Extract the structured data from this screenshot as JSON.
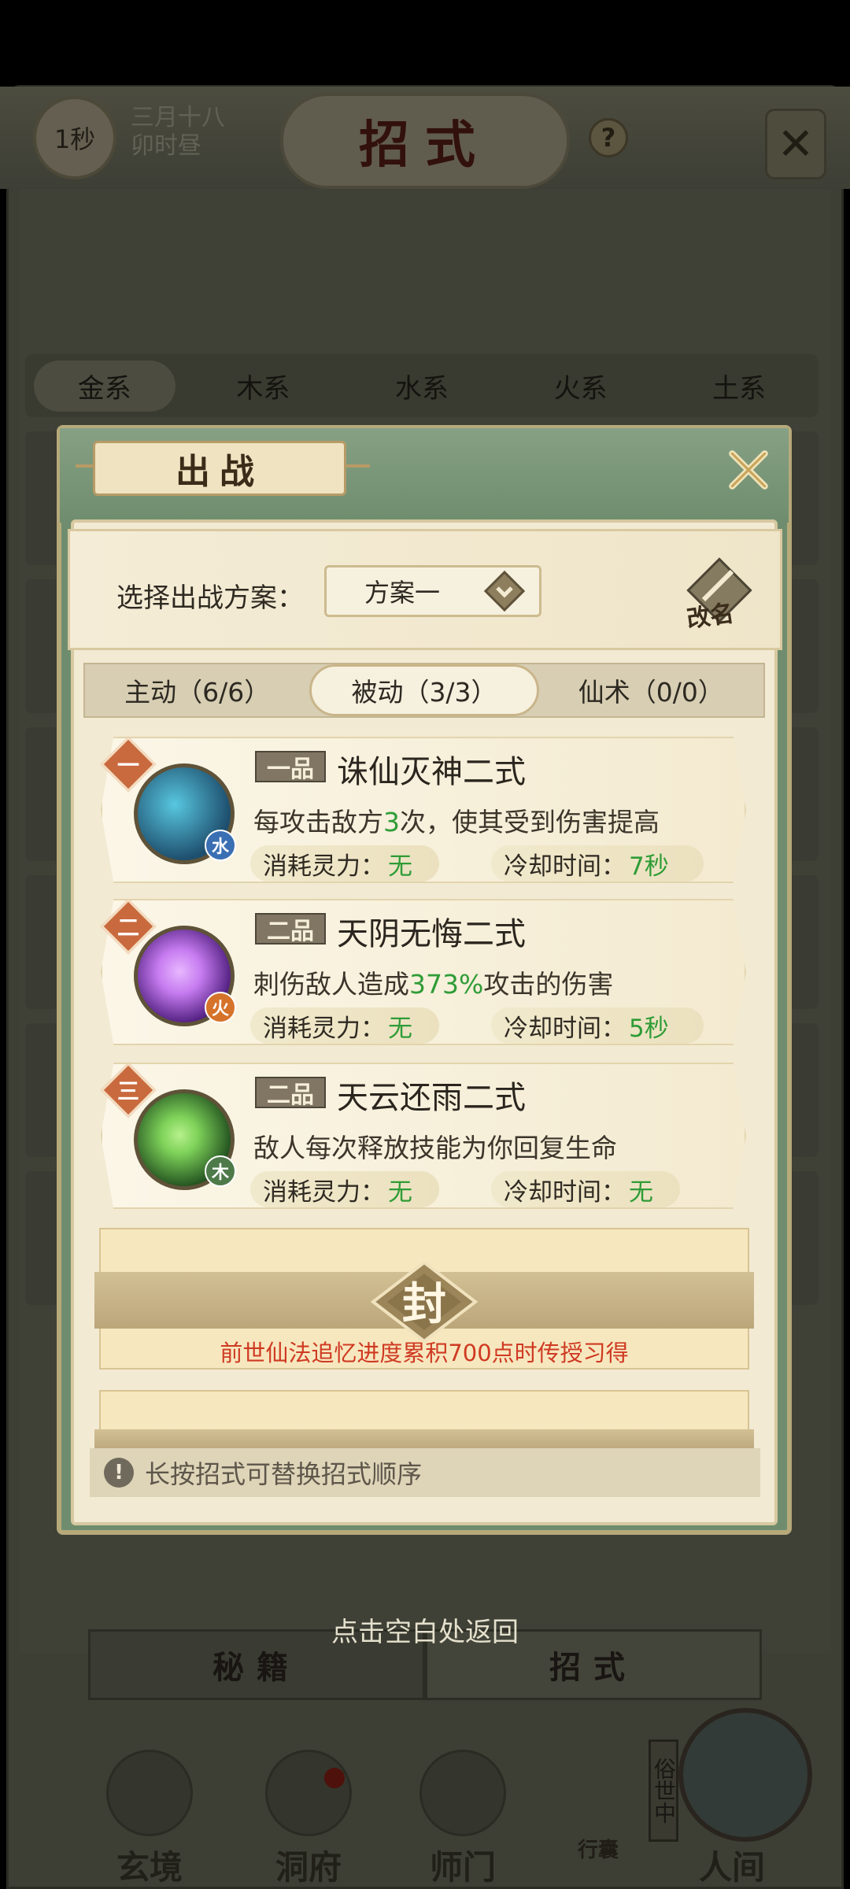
{
  "header": {
    "time_badge": "1秒",
    "date_line1": "三月十八",
    "date_line2": "卯时昼",
    "title": "招式",
    "help_glyph": "?",
    "close_glyph": "✕"
  },
  "element_tabs": [
    "金系",
    "木系",
    "水系",
    "火系",
    "土系"
  ],
  "element_tab_selected": "金系",
  "modal": {
    "title": "出战",
    "plan_label": "选择出战方案：",
    "plan_value": "方案一",
    "rename_label": "改名",
    "tabs": [
      {
        "label": "主动（6/6）",
        "selected": false
      },
      {
        "label": "被动（3/3）",
        "selected": true
      },
      {
        "label": "仙术（0/0）",
        "selected": false
      }
    ],
    "skills": [
      {
        "rank": "一",
        "grade": "一品",
        "name": "诛仙灭神二式",
        "desc_before": "每攻击敌方",
        "desc_hl": "3",
        "desc_after": "次，使其受到伤害提高",
        "element": "水",
        "element_color": "#3b6fb3",
        "cost_label": "消耗灵力：",
        "cost_value": "无",
        "cd_label": "冷却时间：",
        "cd_value": "7秒",
        "icon_colors": [
          "#1e4f6e",
          "#58c7e0"
        ]
      },
      {
        "rank": "二",
        "grade": "二品",
        "name": "天阴无悔二式",
        "desc_before": "刺伤敌人造成",
        "desc_hl": "373%",
        "desc_after": "攻击的伤害",
        "element": "火",
        "element_color": "#d6732a",
        "cost_label": "消耗灵力：",
        "cost_value": "无",
        "cd_label": "冷却时间：",
        "cd_value": "5秒",
        "icon_colors": [
          "#4a1a7a",
          "#c77cf0"
        ]
      },
      {
        "rank": "三",
        "grade": "二品",
        "name": "天云还雨二式",
        "desc_before": "敌人每次释放技能为你回复生命",
        "desc_hl": "",
        "desc_after": "",
        "element": "木",
        "element_color": "#4e7a4a",
        "cost_label": "消耗灵力：",
        "cost_value": "无",
        "cd_label": "冷却时间：",
        "cd_value": "无",
        "icon_colors": [
          "#1d4a1c",
          "#7fd35a"
        ]
      }
    ],
    "sealed": {
      "glyph": "封",
      "note": "前世仙法追忆进度累积700点时传授习得"
    },
    "tip_icon": "!",
    "tip": "长按招式可替换招式顺序"
  },
  "return_hint": "点击空白处返回",
  "bottom_tabs": [
    {
      "label": "秘籍",
      "selected": false
    },
    {
      "label": "招式",
      "selected": true
    }
  ],
  "bottom_nav": [
    {
      "label": "玄境",
      "icon": "scroll-icon"
    },
    {
      "label": "洞府",
      "icon": "pavilion-icon"
    },
    {
      "label": "师门",
      "icon": "banner-icon"
    },
    {
      "label": "行囊",
      "icon": "bag-icon"
    },
    {
      "label": "人间",
      "icon": "landscape-icon"
    }
  ],
  "bottom_nav_side_label": "俗世中",
  "colors": {
    "modal_green": "#6f8d6e",
    "panel_cream": "#f2ead3",
    "highlight_green": "#2f9c37",
    "sealed_red": "#cf3a22"
  }
}
